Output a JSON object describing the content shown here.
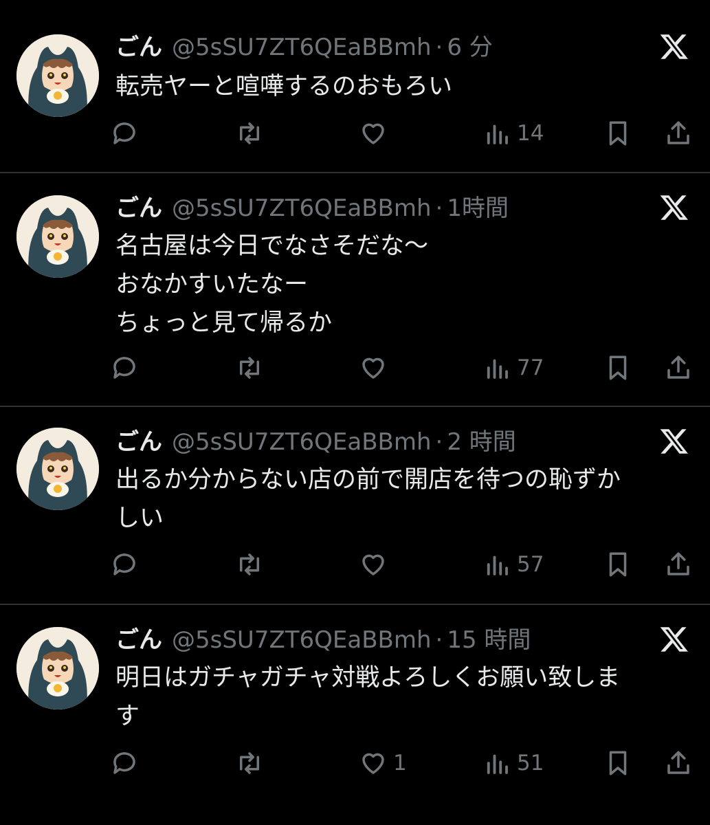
{
  "tweets": [
    {
      "name": "ごん",
      "handle": "@5sSU7ZT6QEaBBmh",
      "dot": "·",
      "time": "6 分",
      "lines": [
        "転売ヤーと喧嘩するのおもろい"
      ],
      "like_count": "",
      "view_count": "14"
    },
    {
      "name": "ごん",
      "handle": "@5sSU7ZT6QEaBBmh",
      "dot": "·",
      "time": "1時間",
      "lines": [
        "名古屋は今日でなさそだな～",
        "おなかすいたなー",
        "ちょっと見て帰るか"
      ],
      "like_count": "",
      "view_count": "77"
    },
    {
      "name": "ごん",
      "handle": "@5sSU7ZT6QEaBBmh",
      "dot": "·",
      "time": "2 時間",
      "lines": [
        "出るか分からない店の前で開店を待つの恥ずか",
        "しい"
      ],
      "like_count": "",
      "view_count": "57"
    },
    {
      "name": "ごん",
      "handle": "@5sSU7ZT6QEaBBmh",
      "dot": "·",
      "time": "15 時間",
      "lines": [
        "明日はガチャガチャ対戦よろしくお願い致しま",
        "す"
      ],
      "like_count": "1",
      "view_count": "51"
    }
  ],
  "icons": {
    "reply": "reply-icon",
    "retweet": "retweet-icon",
    "like": "heart-icon",
    "views": "views-icon",
    "bookmark": "bookmark-icon",
    "share": "share-icon",
    "brand": "x-logo-icon"
  },
  "colors": {
    "background": "#000000",
    "text": "#e7e9ea",
    "muted": "#71767b",
    "divider": "#2f3336"
  }
}
